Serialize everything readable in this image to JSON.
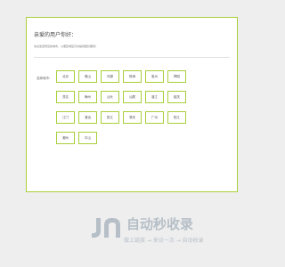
{
  "card": {
    "greeting": "亲爱的用户你好：",
    "description": "请点击您附近的城市，以便区域显示并提供更好服务！",
    "select_label": "选择城市："
  },
  "cities": [
    "北京",
    "佛山",
    "河源",
    "珠海",
    "惠州",
    "揭阳",
    "茂名",
    "梅州",
    "汕头",
    "汕尾",
    "湛江",
    "韶关",
    "江门",
    "清远",
    "阳江",
    "肇庆",
    "广州",
    "阳江",
    "潮州",
    "中山"
  ],
  "footer": {
    "title": "自动秒收录",
    "subtitle": "做上链接 → 来访一次 → 自动收录",
    "logo_color": "#b6bfc7"
  },
  "colors": {
    "accent": "#a8cf3a",
    "background": "#eeeeee"
  }
}
